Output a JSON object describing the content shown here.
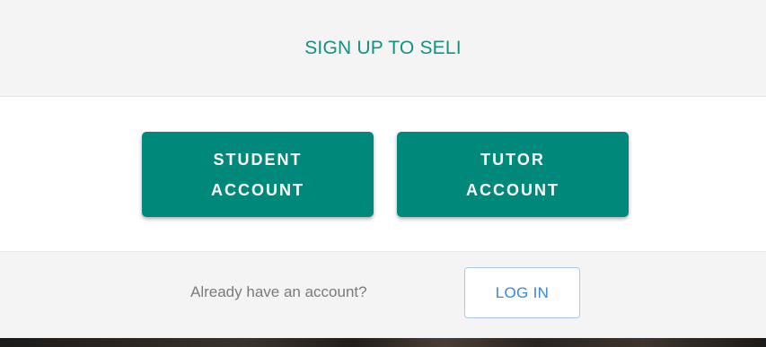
{
  "header": {
    "title": "SIGN UP TO SELI"
  },
  "accounts": {
    "student": {
      "line1": "STUDENT",
      "line2": "ACCOUNT"
    },
    "tutor": {
      "line1": "TUTOR",
      "line2": "ACCOUNT"
    }
  },
  "footer": {
    "prompt": "Already have an account?",
    "login_label": "LOG IN"
  },
  "colors": {
    "accent": "#00897b",
    "title": "#168f7f",
    "link": "#3c86d6"
  }
}
